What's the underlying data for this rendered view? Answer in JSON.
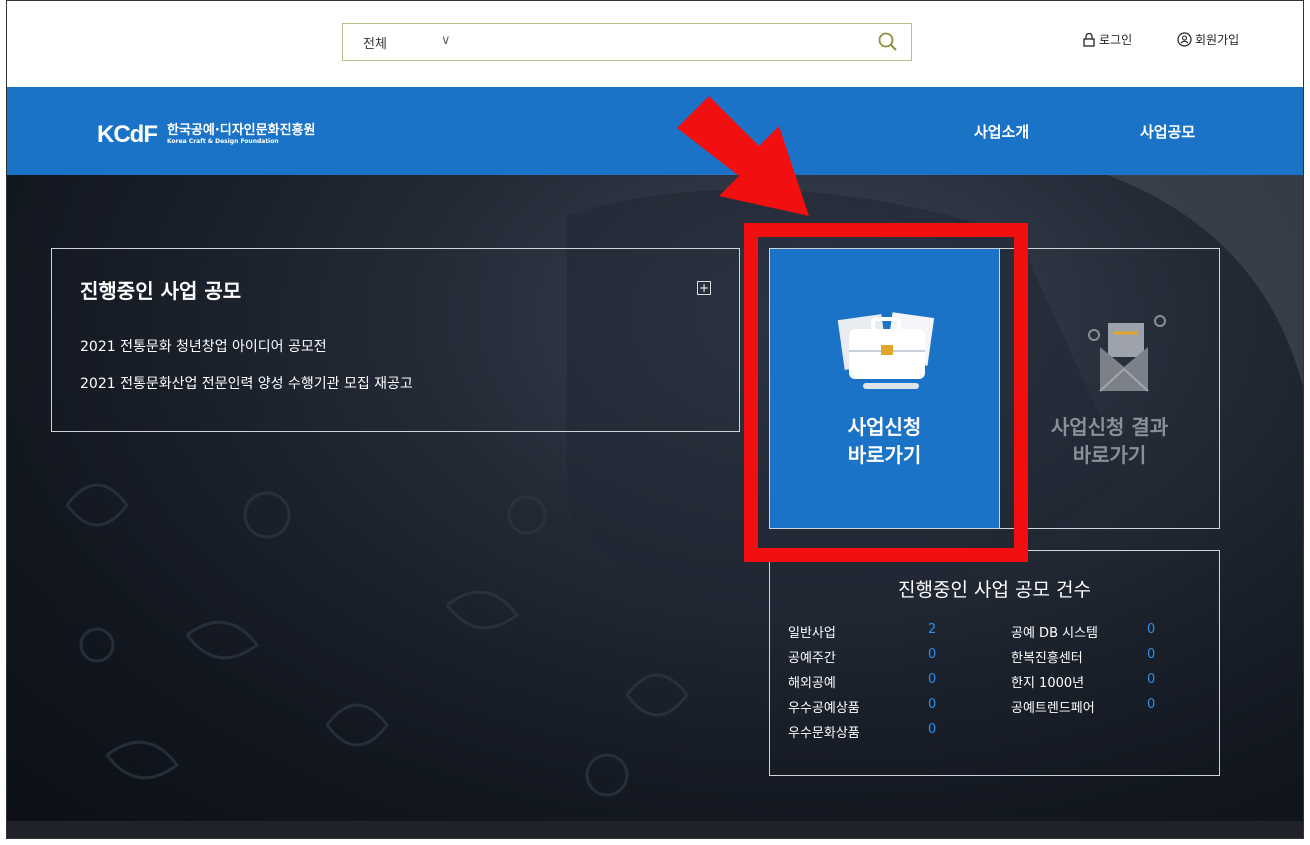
{
  "search": {
    "category": "전체"
  },
  "util": {
    "login": "로그인",
    "signup": "회원가입"
  },
  "brand": {
    "mark": "KCdF",
    "name_kr": "한국공예·디자인문화진흥원",
    "name_en": "Korea Craft & Design Foundation"
  },
  "nav": {
    "items": [
      "사업소개",
      "사업공모"
    ]
  },
  "projects": {
    "title": "진행중인 사업 공모",
    "items": [
      "2021 전통문화 청년창업 아이디어 공모전",
      "2021 전통문화산업 전문인력 양성 수행기관 모집 재공고"
    ]
  },
  "apply": {
    "line1": "사업신청",
    "line2": "바로가기"
  },
  "result": {
    "line1": "사업신청 결과",
    "line2": "바로가기"
  },
  "counts": {
    "title": "진행중인 사업 공모 건수",
    "left": [
      {
        "label": "일반사업",
        "value": "2"
      },
      {
        "label": "공예주간",
        "value": "0"
      },
      {
        "label": "해외공예",
        "value": "0"
      },
      {
        "label": "우수공예상품",
        "value": "0"
      },
      {
        "label": "우수문화상품",
        "value": "0"
      }
    ],
    "right": [
      {
        "label": "공예 DB 시스템",
        "value": "0"
      },
      {
        "label": "한복진흥센터",
        "value": "0"
      },
      {
        "label": "한지 1000년",
        "value": "0"
      },
      {
        "label": "공예트렌드페어",
        "value": "0"
      }
    ]
  },
  "colors": {
    "nav_blue": "#1b73c8",
    "highlight_red": "#f10f0f",
    "count_blue": "#2f8fe6"
  }
}
